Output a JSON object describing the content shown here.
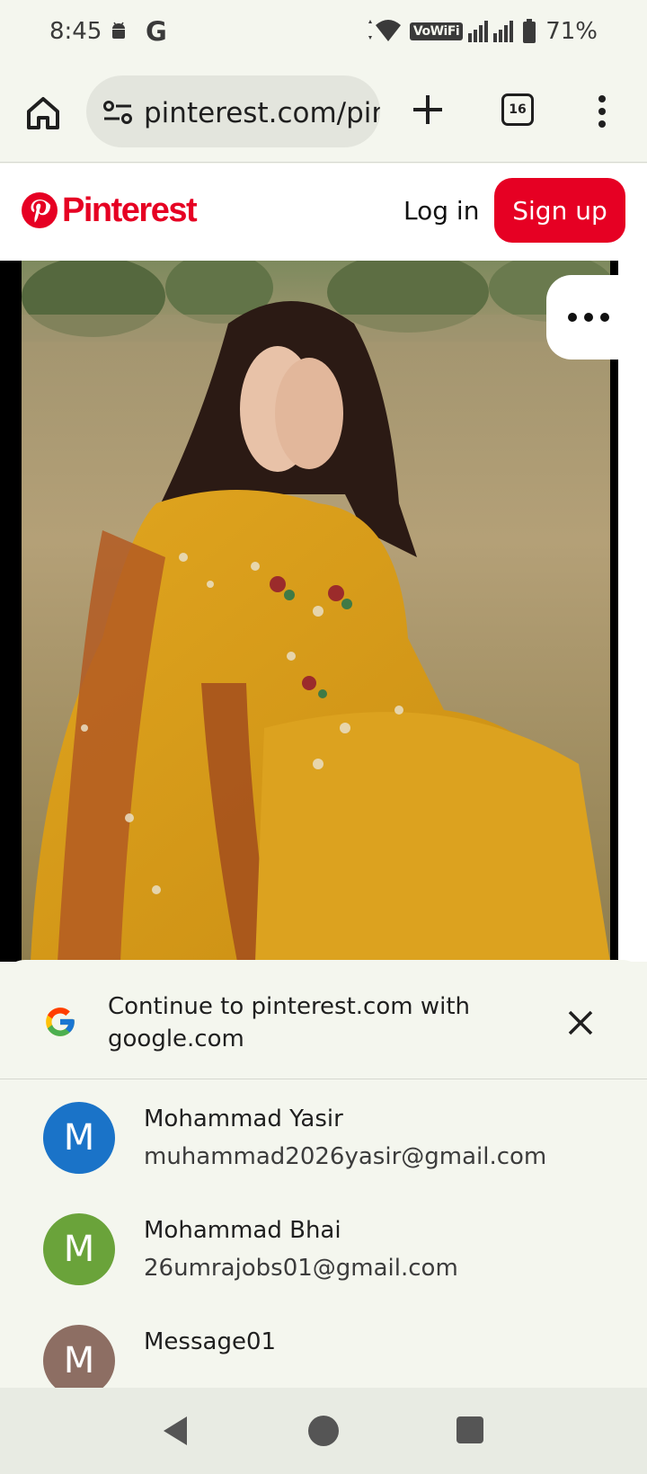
{
  "status_bar": {
    "time": "8:45",
    "carrier_glyph": "G",
    "vowifi": "VoWiFi",
    "battery": "71%",
    "icons": [
      "android-icon",
      "wifi-icon",
      "signal-icon",
      "battery-icon"
    ]
  },
  "browser": {
    "url": "pinterest.com/pir",
    "tab_count": "16",
    "icons": [
      "home-icon",
      "tune-icon",
      "plus-icon",
      "tabs-icon",
      "more-vert-icon"
    ]
  },
  "pinterest": {
    "logo_text": "Pinterest",
    "login_label": "Log in",
    "signup_label": "Sign up",
    "brand_color": "#e60023"
  },
  "sheet": {
    "title": "Continue to pinterest.com with google.com",
    "accounts": [
      {
        "initial": "M",
        "name": "Mohammad Yasir",
        "email": "muhammad2026yasir@gmail.com",
        "color": "#1a73c8"
      },
      {
        "initial": "M",
        "name": "Mohammad Bhai",
        "email": "26umrajobs01@gmail.com",
        "color": "#6aa33a"
      },
      {
        "initial": "M",
        "name": "Message01",
        "email": "",
        "color": "#8d6e63"
      }
    ]
  },
  "nav": {
    "icons": [
      "back-icon",
      "home-circle-icon",
      "recents-icon"
    ]
  }
}
